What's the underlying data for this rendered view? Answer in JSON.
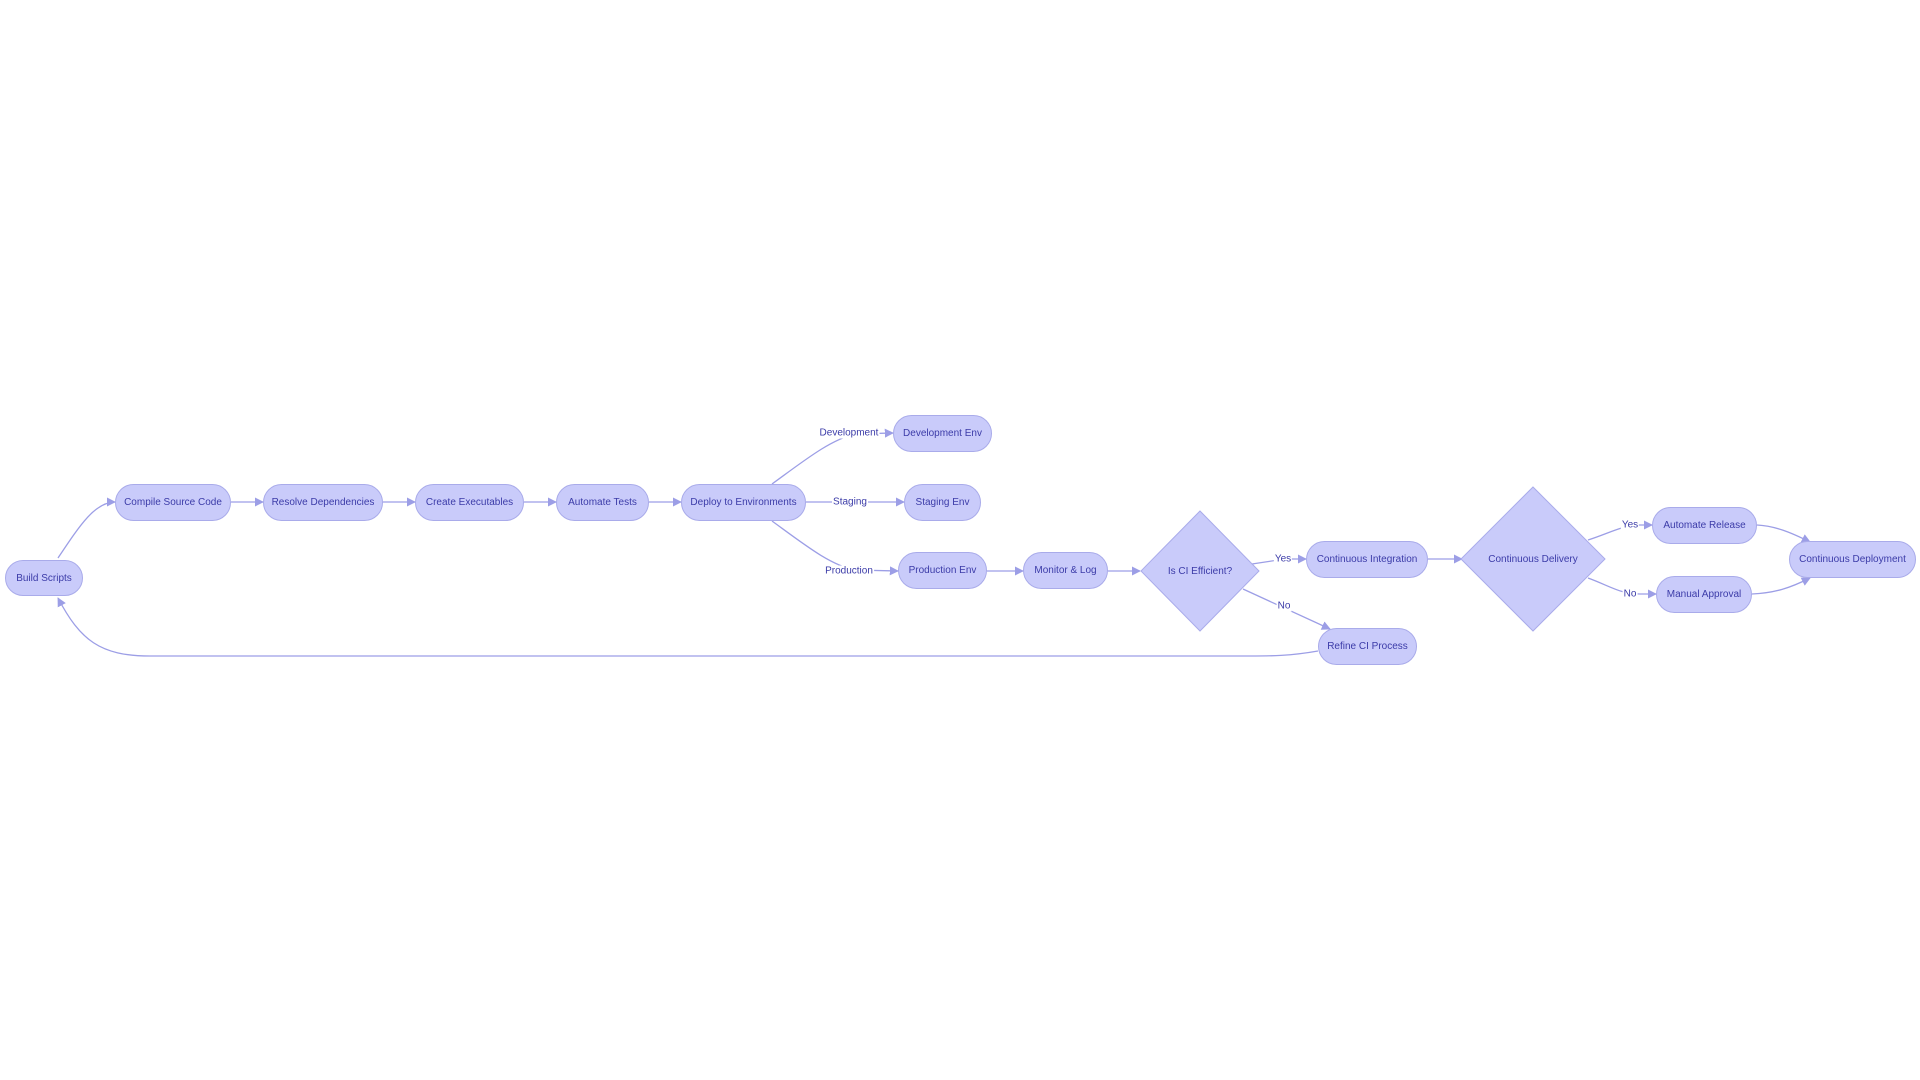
{
  "diagram": {
    "type": "flowchart",
    "colors": {
      "node_fill": "#c9cbfa",
      "node_border": "#a9abea",
      "edge": "#9c9ee6",
      "text": "#3b3ba8",
      "background": "#ffffff"
    },
    "nodes": {
      "build_scripts": "Build Scripts",
      "compile_source_code": "Compile Source Code",
      "resolve_dependencies": "Resolve Dependencies",
      "create_executables": "Create Executables",
      "automate_tests": "Automate Tests",
      "deploy_to_environments": "Deploy to Environments",
      "development_env": "Development Env",
      "staging_env": "Staging Env",
      "production_env": "Production Env",
      "monitor_log": "Monitor & Log",
      "is_ci_efficient": "Is CI Efficient?",
      "continuous_integration": "Continuous Integration",
      "refine_ci_process": "Refine CI Process",
      "continuous_delivery": "Continuous Delivery",
      "automate_release": "Automate Release",
      "manual_approval": "Manual Approval",
      "continuous_deployment": "Continuous Deployment"
    },
    "edge_labels": {
      "development": "Development",
      "staging": "Staging",
      "production": "Production",
      "ci_yes": "Yes",
      "ci_no": "No",
      "cd_yes": "Yes",
      "cd_no": "No"
    },
    "edges": [
      [
        "build_scripts",
        "compile_source_code",
        ""
      ],
      [
        "compile_source_code",
        "resolve_dependencies",
        ""
      ],
      [
        "resolve_dependencies",
        "create_executables",
        ""
      ],
      [
        "create_executables",
        "automate_tests",
        ""
      ],
      [
        "automate_tests",
        "deploy_to_environments",
        ""
      ],
      [
        "deploy_to_environments",
        "development_env",
        "Development"
      ],
      [
        "deploy_to_environments",
        "staging_env",
        "Staging"
      ],
      [
        "deploy_to_environments",
        "production_env",
        "Production"
      ],
      [
        "production_env",
        "monitor_log",
        ""
      ],
      [
        "monitor_log",
        "is_ci_efficient",
        ""
      ],
      [
        "is_ci_efficient",
        "continuous_integration",
        "Yes"
      ],
      [
        "is_ci_efficient",
        "refine_ci_process",
        "No"
      ],
      [
        "refine_ci_process",
        "build_scripts",
        ""
      ],
      [
        "continuous_integration",
        "continuous_delivery",
        ""
      ],
      [
        "continuous_delivery",
        "automate_release",
        "Yes"
      ],
      [
        "continuous_delivery",
        "manual_approval",
        "No"
      ],
      [
        "automate_release",
        "continuous_deployment",
        ""
      ],
      [
        "manual_approval",
        "continuous_deployment",
        ""
      ]
    ]
  }
}
